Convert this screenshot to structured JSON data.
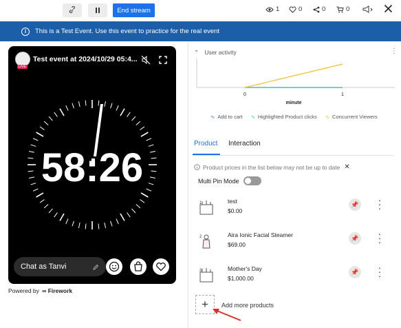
{
  "toolbar": {
    "link_icon": "link-icon",
    "pause_icon": "pause-icon",
    "end_stream_label": "End stream",
    "views": "1",
    "likes": "0",
    "shares": "0",
    "cart": "0",
    "close_icon": "close-icon"
  },
  "banner": {
    "text": "This is a Test Event. Use this event to practice for the real event"
  },
  "video": {
    "title": "Test event at 2024/10/29 05:4...",
    "live_badge": "LIVE",
    "clock_text": "58:26",
    "chat_placeholder": "Chat as Tanvi"
  },
  "powered_by": "Powered by",
  "powered_brand": "Firework",
  "user_activity": {
    "header": "User activity",
    "chart_data": {
      "type": "line",
      "x": [
        0,
        1
      ],
      "xlabel": "minute",
      "xticks": [
        "0",
        "1"
      ],
      "series": [
        {
          "name": "Add to cart",
          "color": "#3a7bd5",
          "values": [
            0,
            0
          ]
        },
        {
          "name": "Highlighted Product clicks",
          "color": "#3ec9a7",
          "values": [
            0,
            0
          ]
        },
        {
          "name": "Concurrent Viewers",
          "color": "#f2c12e",
          "values": [
            0,
            1
          ]
        }
      ],
      "grid": false,
      "legend_placement": "bottom"
    }
  },
  "tabs": {
    "product": "Product",
    "interaction": "Interaction"
  },
  "notice": "Product prices in the list below may not be up to date",
  "multi_pin_label": "Multi Pin Mode",
  "products": [
    {
      "index": "1",
      "name": "test",
      "price": "$0.00"
    },
    {
      "index": "2",
      "name": "Aira Ionic Facial Steamer",
      "price": "$69.00"
    },
    {
      "index": "3",
      "name": "Mother's Day",
      "price": "$1,000.00"
    }
  ],
  "add_more_label": "Add more products",
  "colors": {
    "accent": "#1a73e8",
    "banner": "#1c5fa8",
    "arrow": "#d93025"
  }
}
